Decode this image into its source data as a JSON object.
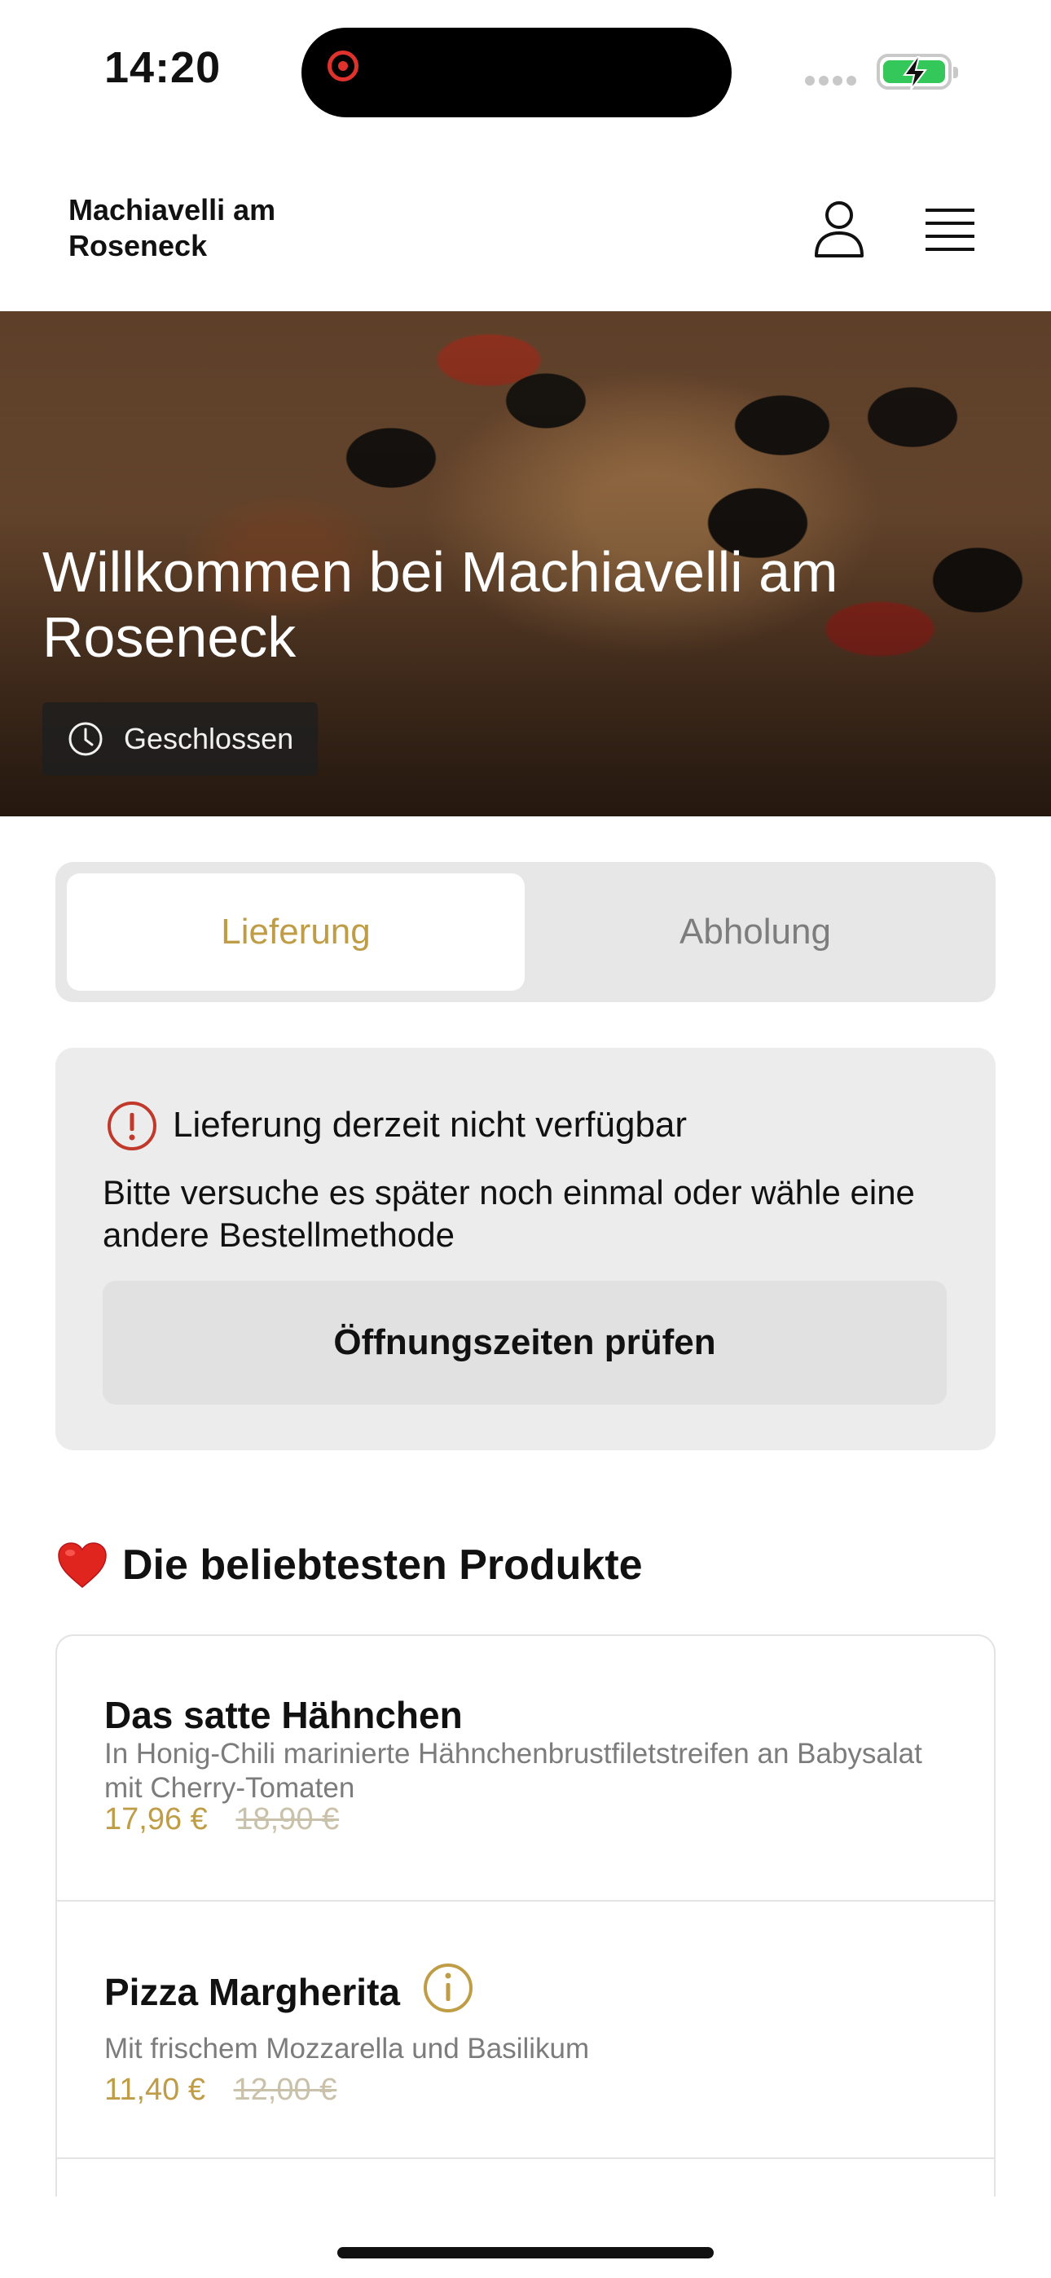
{
  "status_bar": {
    "time": "14:20"
  },
  "header": {
    "restaurant_name": "Machiavelli am Roseneck"
  },
  "hero": {
    "title": "Willkommen bei Machiavelli am Roseneck",
    "status": "Geschlossen"
  },
  "order_mode": {
    "tabs": [
      {
        "label": "Lieferung",
        "active": true
      },
      {
        "label": "Abholung",
        "active": false
      }
    ]
  },
  "notice": {
    "title": "Lieferung derzeit nicht verfügbar",
    "text": "Bitte versuche es später noch einmal oder wähle eine andere Bestellmethode",
    "button": "Öffnungszeiten prüfen"
  },
  "popular": {
    "title": "Die beliebtesten Produkte",
    "items": [
      {
        "name": "Das satte Hähnchen",
        "description": "In Honig-Chili marinierte Hähnchenbrustfiletstreifen an Babysalat mit Cherry-Tomaten",
        "price": "17,96 €",
        "old_price": "18,90 €"
      },
      {
        "name": "Pizza Margherita",
        "description": "Mit frischem Mozzarella und Basilikum",
        "price": "11,40 €",
        "old_price": "12,00 €"
      }
    ]
  },
  "colors": {
    "accent": "#bf9d46",
    "alert": "#c0392b",
    "battery": "#34c759"
  },
  "icons": [
    "record-icon",
    "battery-charging-icon",
    "user-icon",
    "menu-icon",
    "clock-icon",
    "info-icon",
    "heart-icon"
  ]
}
